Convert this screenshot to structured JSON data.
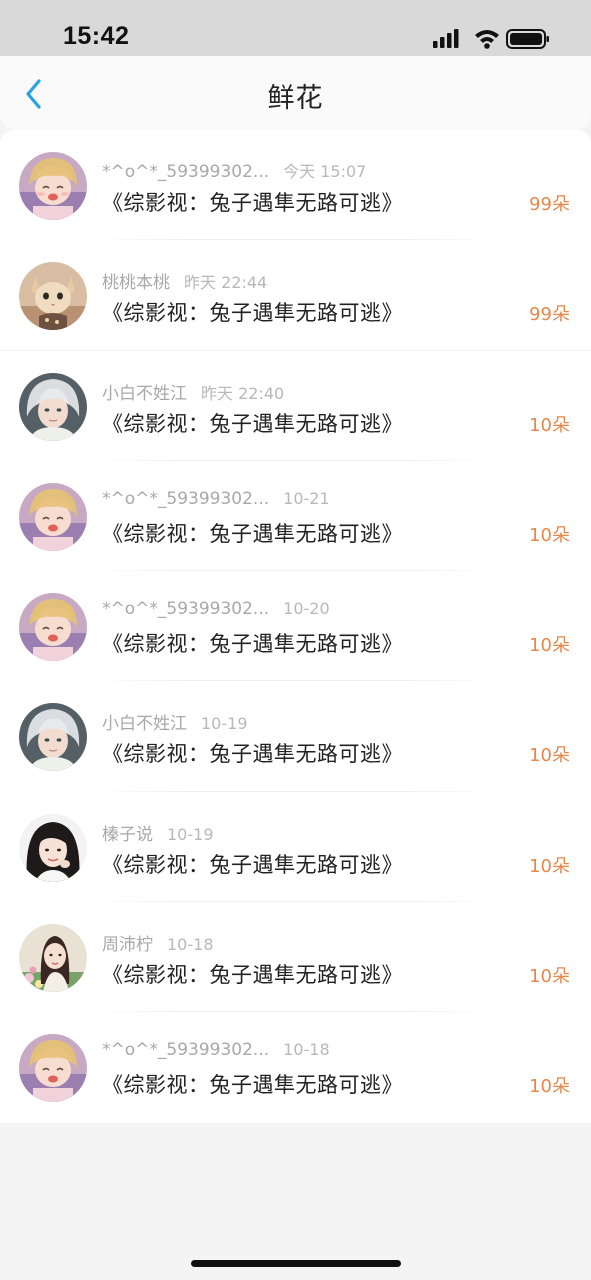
{
  "status_bar": {
    "time": "15:42"
  },
  "header": {
    "title": "鲜花"
  },
  "colors": {
    "accent": "#2aa0e6",
    "count": "#e8874a"
  },
  "items": [
    {
      "name": "*^o^*_59399302...",
      "time": "今天 15:07",
      "book": "《综影视：兔子遇隼无路可逃》",
      "count": "99朵",
      "avatar": "anime-blonde-avatar"
    },
    {
      "name": "桃桃本桃",
      "time": "昨天 22:44",
      "book": "《综影视：兔子遇隼无路可逃》",
      "count": "99朵",
      "avatar": "cat-avatar"
    },
    {
      "name": "小白不姓江",
      "time": "昨天 22:40",
      "book": "《综影视：兔子遇隼无路可逃》",
      "count": "10朵",
      "avatar": "anime-silver-hair-avatar"
    },
    {
      "name": "*^o^*_59399302...",
      "time": "10-21",
      "book": "《综影视：兔子遇隼无路可逃》",
      "count": "10朵",
      "avatar": "anime-blonde-avatar"
    },
    {
      "name": "*^o^*_59399302...",
      "time": "10-20",
      "book": "《综影视：兔子遇隼无路可逃》",
      "count": "10朵",
      "avatar": "anime-blonde-avatar"
    },
    {
      "name": "小白不姓江",
      "time": "10-19",
      "book": "《综影视：兔子遇隼无路可逃》",
      "count": "10朵",
      "avatar": "anime-silver-hair-avatar"
    },
    {
      "name": "榛子说",
      "time": "10-19",
      "book": "《综影视：兔子遇隼无路可逃》",
      "count": "10朵",
      "avatar": "girl-dark-hair-avatar"
    },
    {
      "name": "周沛柠",
      "time": "10-18",
      "book": "《综影视：兔子遇隼无路可逃》",
      "count": "10朵",
      "avatar": "girl-flowers-avatar"
    },
    {
      "name": "*^o^*_59399302...",
      "time": "10-18",
      "book": "《综影视：兔子遇隼无路可逃》",
      "count": "10朵",
      "avatar": "anime-blonde-avatar"
    }
  ]
}
